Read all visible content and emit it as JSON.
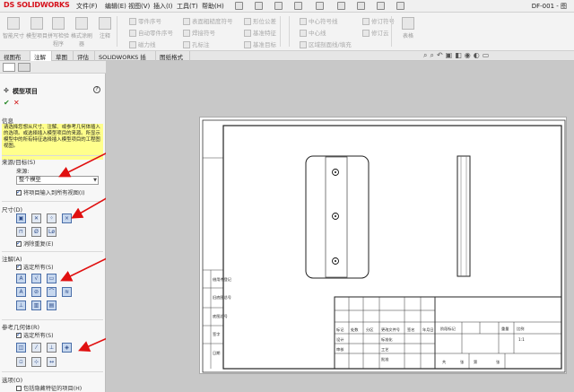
{
  "titlebar": {
    "logo": "DS SOLIDWORKS",
    "menus": [
      "文件(F)",
      "编辑(E)",
      "视图(V)",
      "插入(I)",
      "工具(T)",
      "帮助(H)"
    ],
    "doc_title": "DF-001 - 图"
  },
  "ribbon": {
    "big_buttons": [
      {
        "label": "智能尺寸"
      },
      {
        "label": "模型项目"
      },
      {
        "label": "拼写检验程序"
      },
      {
        "label": "格式涂刷器"
      },
      {
        "label": "注释"
      }
    ],
    "small_col1": [
      "零件序号",
      "自动零件序号",
      "磁力线"
    ],
    "small_col2": [
      "表面粗糙度符号",
      "焊接符号",
      "孔标注"
    ],
    "small_col3": [
      "形位公差",
      "基准特征",
      "基准目标"
    ],
    "small_col4": [
      "中心符号线",
      "中心线",
      "区域剖面线/填充"
    ],
    "small_col5": [
      "修订符号",
      "修订云"
    ],
    "big_last": {
      "label": "表格"
    }
  },
  "tabs": [
    {
      "label": "视图布局",
      "active": false
    },
    {
      "label": "注解",
      "active": true
    },
    {
      "label": "草图",
      "active": false
    },
    {
      "label": "评估",
      "active": false
    },
    {
      "label": "SOLIDWORKS 插件",
      "active": false
    },
    {
      "label": "图纸格式",
      "active": false
    }
  ],
  "property_manager": {
    "title": "模型项目",
    "help": "?",
    "ok": "✔",
    "cancel": "✕",
    "info_header": "信息",
    "info_text": "请选择您想从尺寸、注解、或参考几何体插入的选项。或选择插入模型项目的来源。所显示模型中的所有特征选择插入模型项目的工程图视图。",
    "source_header": "来源/目标(S)",
    "source_label": "来源:",
    "source_value": "整个模型",
    "import_all_views": "将项目输入到所有视图(I)",
    "dims_header": "尺寸(D)",
    "dims_icon_labels": [
      "Ø",
      "Lø"
    ],
    "remove_dups": "消除重复(E)",
    "ann_header": "注解(A)",
    "ann_select_all": "选定所有(S)",
    "refgeo_header": "参考几何体(R)",
    "refgeo_select_all": "选定所有(S)",
    "options_header": "选项(O)",
    "options_hidden": "包括隐藏特征的项目(H)"
  },
  "title_block": {
    "left_cells": [
      "设计",
      "审核",
      "工艺",
      "标准化",
      "批准"
    ],
    "rev_headers": [
      "标记",
      "处数",
      "分区",
      "更改文件号",
      "签名",
      "年月日"
    ],
    "material_headers": [
      "阶段标记",
      "重量",
      "比例"
    ],
    "scale_value": "1:1",
    "sign_row": [
      "共",
      "张",
      "第",
      "张"
    ]
  },
  "colors": {
    "accent": "#d6101a",
    "info_bg": "#ffff8c",
    "arrow": "#e01010"
  }
}
